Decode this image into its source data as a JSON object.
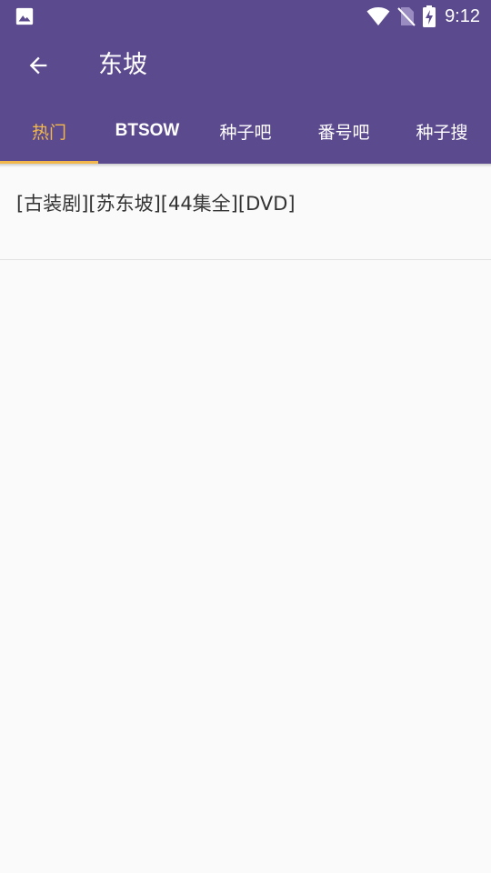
{
  "status_bar": {
    "time": "9:12",
    "left_icon": "image-icon",
    "icons": [
      "wifi-icon",
      "no-sim-icon",
      "battery-charging-icon"
    ]
  },
  "toolbar": {
    "title": "东坡",
    "back_icon": "arrow-back-icon"
  },
  "tabs": [
    {
      "label": "热门",
      "active": true
    },
    {
      "label": "BTSOW",
      "active": false
    },
    {
      "label": "种子吧",
      "active": false
    },
    {
      "label": "番号吧",
      "active": false
    },
    {
      "label": "种子搜",
      "active": false
    }
  ],
  "results": [
    {
      "title": "[古装剧][苏东坡][44集全][DVD]"
    }
  ],
  "colors": {
    "primary": "#5c4a8e",
    "accent": "#f2b84b",
    "background": "#fafafa",
    "text": "#333333",
    "divider": "#e2e2e2"
  }
}
